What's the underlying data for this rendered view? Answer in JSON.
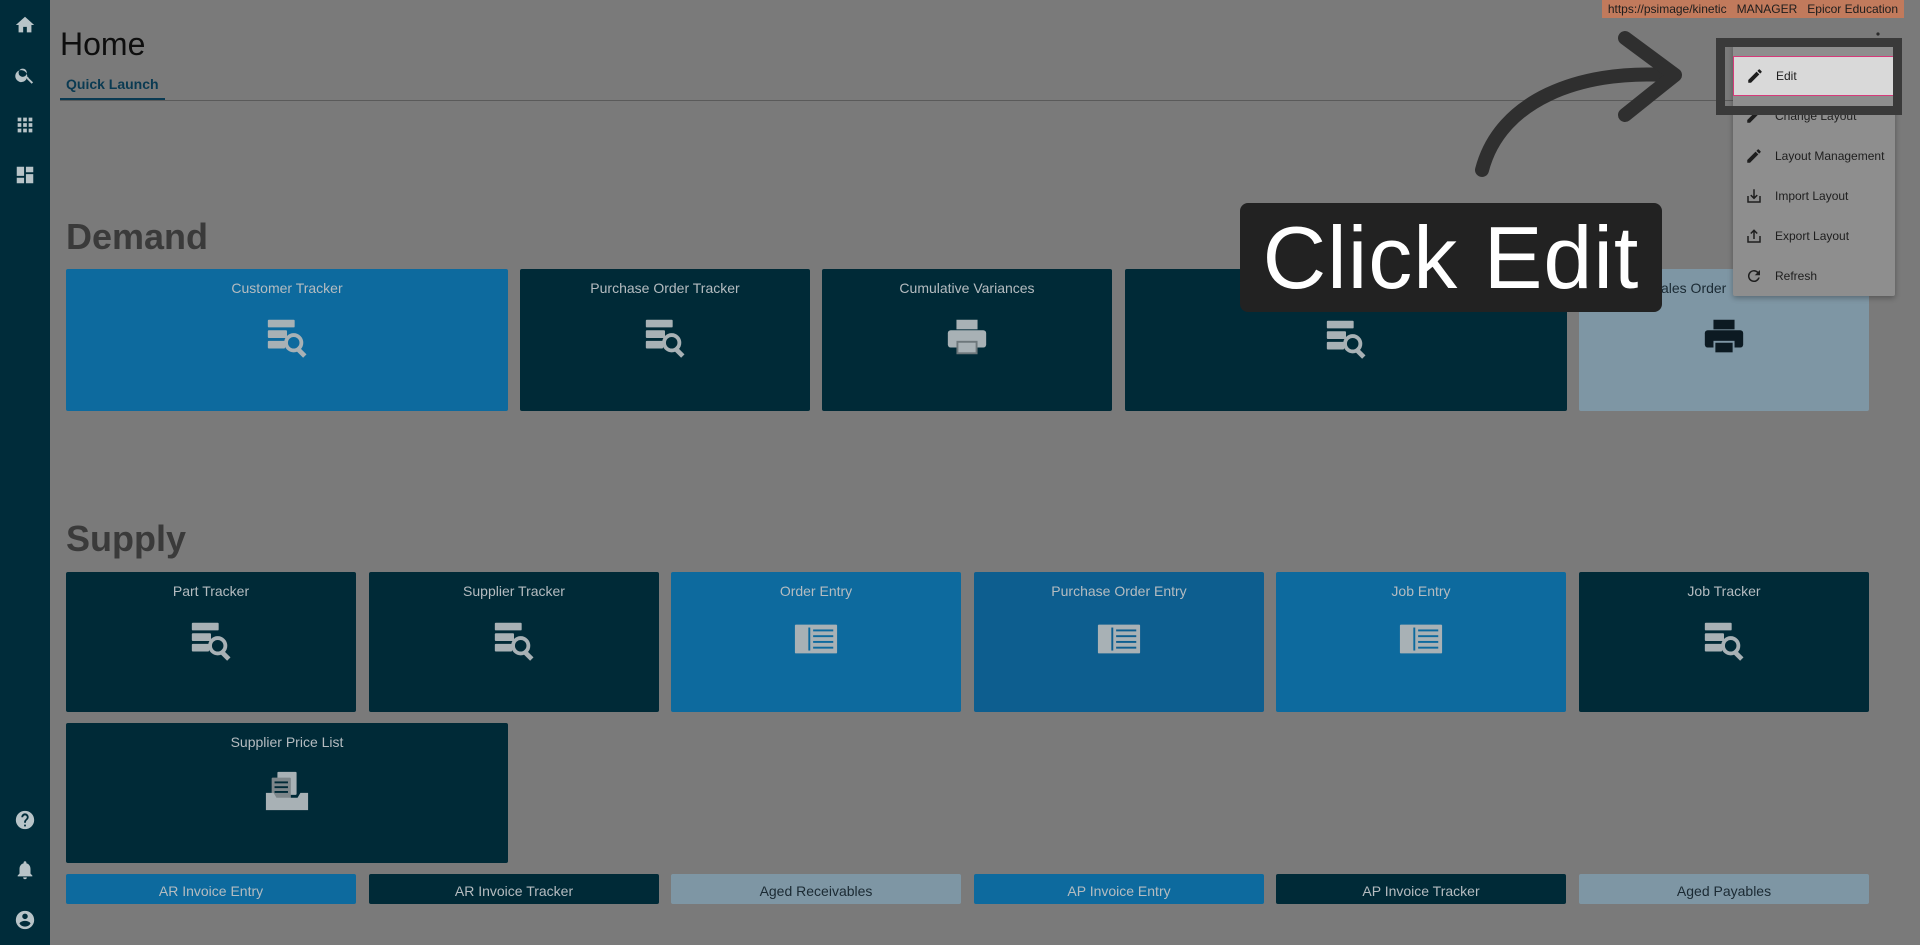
{
  "env": {
    "url": "https://psimage/kinetic",
    "user": "MANAGER",
    "company": "Epicor Education"
  },
  "page": {
    "title": "Home",
    "tab": "Quick Launch"
  },
  "sections": {
    "demand": {
      "title": "Demand"
    },
    "supply": {
      "title": "Supply"
    }
  },
  "demand_tiles": [
    {
      "label": "Customer Tracker",
      "icon": "tracker-icon"
    },
    {
      "label": "Purchase Order Tracker",
      "icon": "tracker-icon"
    },
    {
      "label": "Cumulative Variances",
      "icon": "printer-icon"
    },
    {
      "label": "",
      "icon": "tracker-icon"
    },
    {
      "label": "Sales Order",
      "icon": "printer-icon"
    }
  ],
  "supply_tiles": [
    {
      "label": "Part Tracker",
      "icon": "tracker-icon"
    },
    {
      "label": "Supplier Tracker",
      "icon": "tracker-icon"
    },
    {
      "label": "Order Entry",
      "icon": "form-icon"
    },
    {
      "label": "Purchase Order Entry",
      "icon": "form-icon"
    },
    {
      "label": "Job Entry",
      "icon": "form-icon"
    },
    {
      "label": "Job Tracker",
      "icon": "tracker-icon"
    },
    {
      "label": "Supplier Price List",
      "icon": "document-tray-icon"
    }
  ],
  "bottom_tiles": [
    {
      "label": "AR Invoice Entry"
    },
    {
      "label": "AR Invoice Tracker"
    },
    {
      "label": "Aged Receivables"
    },
    {
      "label": "AP Invoice Entry"
    },
    {
      "label": "AP Invoice Tracker"
    },
    {
      "label": "Aged Payables"
    }
  ],
  "menu": {
    "items": [
      {
        "label": "Edit",
        "icon": "pencil-icon"
      },
      {
        "label": "Change Layout",
        "icon": "pencil-icon"
      },
      {
        "label": "Layout Management",
        "icon": "pencil-icon"
      },
      {
        "label": "Import Layout",
        "icon": "download-icon"
      },
      {
        "label": "Export Layout",
        "icon": "upload-icon"
      },
      {
        "label": "Refresh",
        "icon": "refresh-icon"
      }
    ]
  },
  "tutorial": {
    "callout": "Click Edit"
  },
  "colors": {
    "rail": "#002c3a",
    "tile_light": "#0d6a9e",
    "tile_dark": "#002a37",
    "accent": "#d63a7a"
  }
}
